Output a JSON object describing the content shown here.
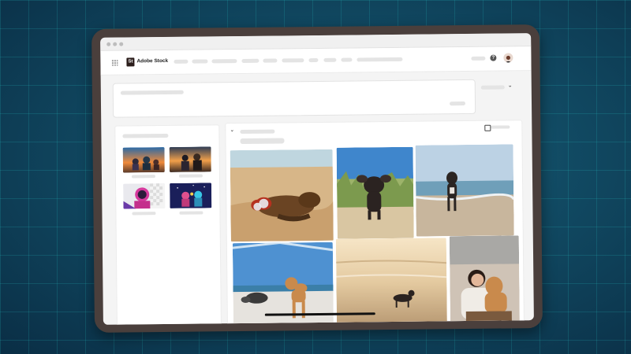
{
  "app": {
    "logo_mark": "St",
    "name": "Adobe Stock"
  },
  "colors": {
    "tablet_frame": "#4a3f3c",
    "screen_bg": "#f4f4f4",
    "placeholder": "#e4e4e4",
    "background": "#114a63"
  },
  "icons": {
    "apps": "apps-grid-icon",
    "help": "help-icon",
    "sort": "chevron-down-icon",
    "collapse": "chevron-down-icon"
  },
  "topbar": {
    "help_glyph": "?"
  },
  "sidebar": {
    "thumbnails": [
      {
        "subject": "cartoon characters against sunset"
      },
      {
        "subject": "fantasy warriors against sunset"
      },
      {
        "subject": "pink astronaut portrait"
      },
      {
        "subject": "neon figures in space"
      }
    ]
  },
  "results": {
    "photos": [
      {
        "subject": "dog with sunglasses lying on sand"
      },
      {
        "subject": "dog standing on dune grass"
      },
      {
        "subject": "dog walking on beach shore"
      },
      {
        "subject": "dog standing on beach with rocks"
      },
      {
        "subject": "dog walking on beach at sunset"
      },
      {
        "subject": "woman hugging dog on beach"
      }
    ]
  }
}
